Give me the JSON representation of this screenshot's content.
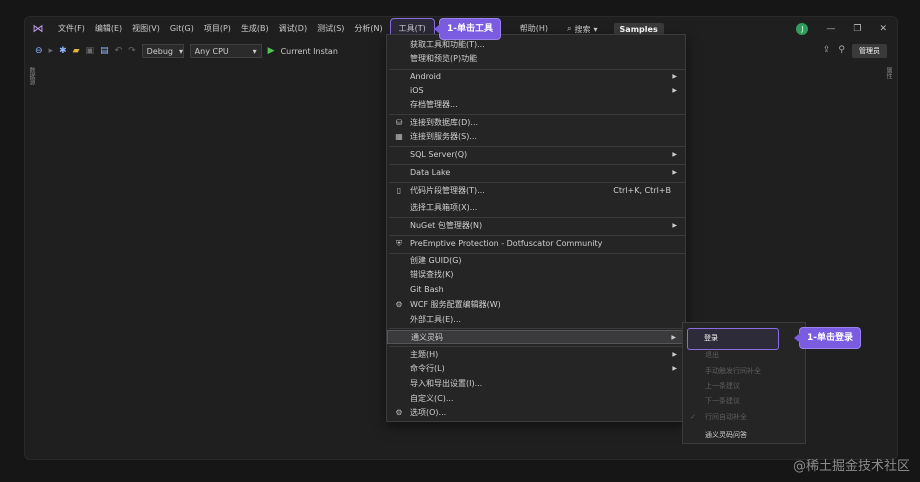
{
  "menubar": {
    "items": [
      "文件(F)",
      "编辑(E)",
      "视图(V)",
      "Git(G)",
      "项目(P)",
      "生成(B)",
      "调试(D)",
      "测试(S)",
      "分析(N)",
      "工具(T)",
      "帮助(H)"
    ],
    "search_label": "搜索",
    "solution_name": "Samples",
    "avatar_letter": "J"
  },
  "toolbar": {
    "config": "Debug",
    "platform": "Any CPU",
    "run_label": "Current Instan",
    "admin_label": "管理员"
  },
  "side_panels": {
    "left": "数据源",
    "right": "属性"
  },
  "tools_menu": {
    "items": [
      {
        "label": "获取工具和功能(T)...",
        "icon": "",
        "arrow": false,
        "shortcut": ""
      },
      {
        "label": "管理和预览(P)功能",
        "icon": "",
        "arrow": false,
        "shortcut": ""
      },
      {
        "label": "Android",
        "icon": "",
        "arrow": true,
        "shortcut": ""
      },
      {
        "label": "iOS",
        "icon": "",
        "arrow": true,
        "shortcut": ""
      },
      {
        "label": "存档管理器...",
        "icon": "",
        "arrow": false,
        "shortcut": ""
      },
      {
        "label": "连接到数据库(D)...",
        "icon": "db-connect-icon",
        "arrow": false,
        "shortcut": ""
      },
      {
        "label": "连接到服务器(S)...",
        "icon": "server-connect-icon",
        "arrow": false,
        "shortcut": ""
      },
      {
        "label": "SQL Server(Q)",
        "icon": "",
        "arrow": true,
        "shortcut": ""
      },
      {
        "label": "Data Lake",
        "icon": "",
        "arrow": true,
        "shortcut": ""
      },
      {
        "label": "代码片段管理器(T)...",
        "icon": "snippet-icon",
        "arrow": false,
        "shortcut": "Ctrl+K, Ctrl+B"
      },
      {
        "label": "选择工具箱项(X)...",
        "icon": "",
        "arrow": false,
        "shortcut": ""
      },
      {
        "label": "NuGet 包管理器(N)",
        "icon": "",
        "arrow": true,
        "shortcut": ""
      },
      {
        "label": "PreEmptive Protection - Dotfuscator Community",
        "icon": "shield-icon",
        "arrow": false,
        "shortcut": ""
      },
      {
        "label": "创建 GUID(G)",
        "icon": "",
        "arrow": false,
        "shortcut": ""
      },
      {
        "label": "错误查找(K)",
        "icon": "",
        "arrow": false,
        "shortcut": ""
      },
      {
        "label": "Git Bash",
        "icon": "",
        "arrow": false,
        "shortcut": ""
      },
      {
        "label": "WCF 服务配置编辑器(W)",
        "icon": "wcf-icon",
        "arrow": false,
        "shortcut": ""
      },
      {
        "label": "外部工具(E)...",
        "icon": "",
        "arrow": false,
        "shortcut": ""
      },
      {
        "label": "通义灵码",
        "icon": "",
        "arrow": true,
        "shortcut": ""
      },
      {
        "label": "主题(H)",
        "icon": "",
        "arrow": true,
        "shortcut": ""
      },
      {
        "label": "命令行(L)",
        "icon": "",
        "arrow": true,
        "shortcut": ""
      },
      {
        "label": "导入和导出设置(I)...",
        "icon": "",
        "arrow": false,
        "shortcut": ""
      },
      {
        "label": "自定义(C)...",
        "icon": "",
        "arrow": false,
        "shortcut": ""
      },
      {
        "label": "选项(O)...",
        "icon": "gear-icon",
        "arrow": false,
        "shortcut": ""
      }
    ]
  },
  "lingma_submenu": {
    "items": [
      {
        "label": "登录",
        "disabled": false
      },
      {
        "label": "退出",
        "disabled": true
      },
      {
        "label": "手动触发行间补全",
        "disabled": true
      },
      {
        "label": "上一条建议",
        "disabled": true
      },
      {
        "label": "下一条建议",
        "disabled": true
      },
      {
        "label": "行间自动补全",
        "disabled": true
      },
      {
        "label": "通义灵码问答",
        "disabled": false
      }
    ]
  },
  "callouts": {
    "tools": "1-单击工具",
    "login": "1-单击登录"
  },
  "watermark": "@稀土掘金技术社区",
  "colors": {
    "accent": "#7a5ce0",
    "run_green": "#4ec94e"
  }
}
